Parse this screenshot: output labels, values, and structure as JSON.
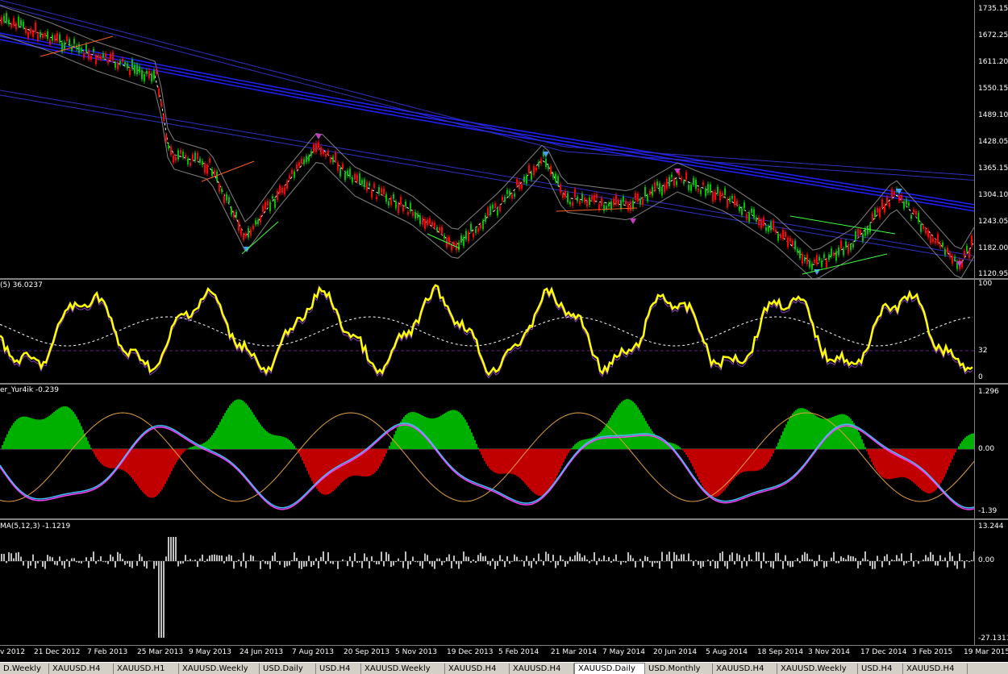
{
  "panes": {
    "price": {
      "y_labels": [
        "1735.15",
        "1672.25",
        "1611.20",
        "1550.15",
        "1489.10",
        "1428.05",
        "1365.15",
        "1304.10",
        "1243.05",
        "1182.00",
        "1120.95"
      ]
    },
    "rsi": {
      "title": "(5) 36.0237",
      "y_labels": [
        "100",
        "32",
        "0"
      ]
    },
    "macd": {
      "title": "er_Yur4ik -0.239",
      "y_labels": [
        "1.296",
        "0.00",
        "-1.39"
      ]
    },
    "osma": {
      "title": "MA(5,12,3) -1.1219",
      "y_labels": [
        "13.244",
        "0.00",
        "-27.1311"
      ]
    }
  },
  "x_axis": {
    "labels": [
      "v 2012",
      "21 Dec 2012",
      "7 Feb 2013",
      "25 Mar 2013",
      "9 May 2013",
      "24 Jun 2013",
      "7 Aug 2013",
      "20 Sep 2013",
      "5 Nov 2013",
      "19 Dec 2013",
      "5 Feb 2014",
      "21 Mar 2014",
      "7 May 2014",
      "20 Jun 2014",
      "5 Aug 2014",
      "18 Sep 2014",
      "3 Nov 2014",
      "17 Dec 2014",
      "3 Feb 2015",
      "19 Mar 2015"
    ]
  },
  "tabs": [
    {
      "label": "D.Weekly"
    },
    {
      "label": "XAUUSD.H4"
    },
    {
      "label": "XAUUSD.H1"
    },
    {
      "label": "XAUUSD.Weekly"
    },
    {
      "label": "USD.Daily"
    },
    {
      "label": "USD.H4"
    },
    {
      "label": "XAUUSD.Weekly"
    },
    {
      "label": "XAUUSD.H4"
    },
    {
      "label": "XAUUSD.H4"
    },
    {
      "label": "XAUUSD.Daily"
    },
    {
      "label": "USD.Monthly"
    },
    {
      "label": "XAUUSD.H4"
    },
    {
      "label": "XAUUSD.Weekly"
    },
    {
      "label": "USD.H4"
    },
    {
      "label": "XAUUSD.H4"
    }
  ],
  "active_tab": "XAUUSD.Daily",
  "colors": {
    "bull_candle": "#00c000",
    "bear_candle": "#ff0000",
    "band_blue": "#2020ff",
    "envelope": "#808080",
    "rsi_line": "#ffff00",
    "macd_pos": "#00b000",
    "macd_neg": "#c00000",
    "macd_fast": "#40c0ff",
    "macd_slow": "#ff40ff",
    "macd_signal": "#e0a040",
    "osma_bar": "#c0c0c0"
  }
}
